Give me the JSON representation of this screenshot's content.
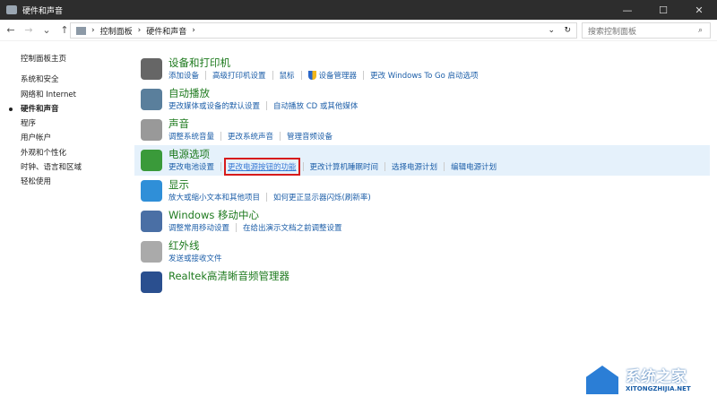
{
  "window": {
    "title": "硬件和声音",
    "minimize": "—",
    "maximize": "☐",
    "close": "✕"
  },
  "address": {
    "back": "←",
    "forward": "→",
    "recent": "⌄",
    "up": "↑",
    "crumbs": [
      "控制面板",
      "硬件和声音"
    ],
    "sep": "›",
    "dropdown": "⌄",
    "refresh": "↻",
    "search_placeholder": "搜索控制面板",
    "search_icon": "⌕"
  },
  "sidebar": {
    "home": "控制面板主页",
    "items": [
      "系统和安全",
      "网络和 Internet",
      "硬件和声音",
      "程序",
      "用户帐户",
      "外观和个性化",
      "时钟、语言和区域",
      "轻松使用"
    ],
    "active": 2
  },
  "sections": [
    {
      "title": "设备和打印机",
      "icon": "printer-icon",
      "color": "#666",
      "links": [
        "添加设备",
        "高级打印机设置",
        "鼠标",
        "设备管理器",
        "更改 Windows To Go 启动选项"
      ]
    },
    {
      "title": "自动播放",
      "icon": "autoplay-icon",
      "color": "#5a7f9c",
      "links": [
        "更改媒体或设备的默认设置",
        "自动播放 CD 或其他媒体"
      ]
    },
    {
      "title": "声音",
      "icon": "speaker-icon",
      "color": "#999",
      "links": [
        "调整系统音量",
        "更改系统声音",
        "管理音频设备"
      ]
    },
    {
      "title": "电源选项",
      "icon": "power-icon",
      "color": "#3a9a3a",
      "links": [
        "更改电池设置",
        "更改电源按钮的功能",
        "更改计算机睡眠时间",
        "选择电源计划",
        "编辑电源计划"
      ]
    },
    {
      "title": "显示",
      "icon": "monitor-icon",
      "color": "#2f8fd8",
      "links": [
        "放大或缩小文本和其他项目",
        "如何更正显示器闪烁(刷新率)"
      ]
    },
    {
      "title": "Windows 移动中心",
      "icon": "mobility-center-icon",
      "color": "#4a6fa5",
      "links": [
        "调整常用移动设置",
        "在给出演示文档之前调整设置"
      ]
    },
    {
      "title": "红外线",
      "icon": "infrared-icon",
      "color": "#aaa",
      "links": [
        "发送或接收文件"
      ]
    },
    {
      "title": "Realtek高清晰音频管理器",
      "icon": "realtek-icon",
      "color": "#2a4f8f",
      "links": []
    }
  ],
  "watermark": {
    "name": "系统之家",
    "url": "XITONGZHIJIA.NET"
  }
}
